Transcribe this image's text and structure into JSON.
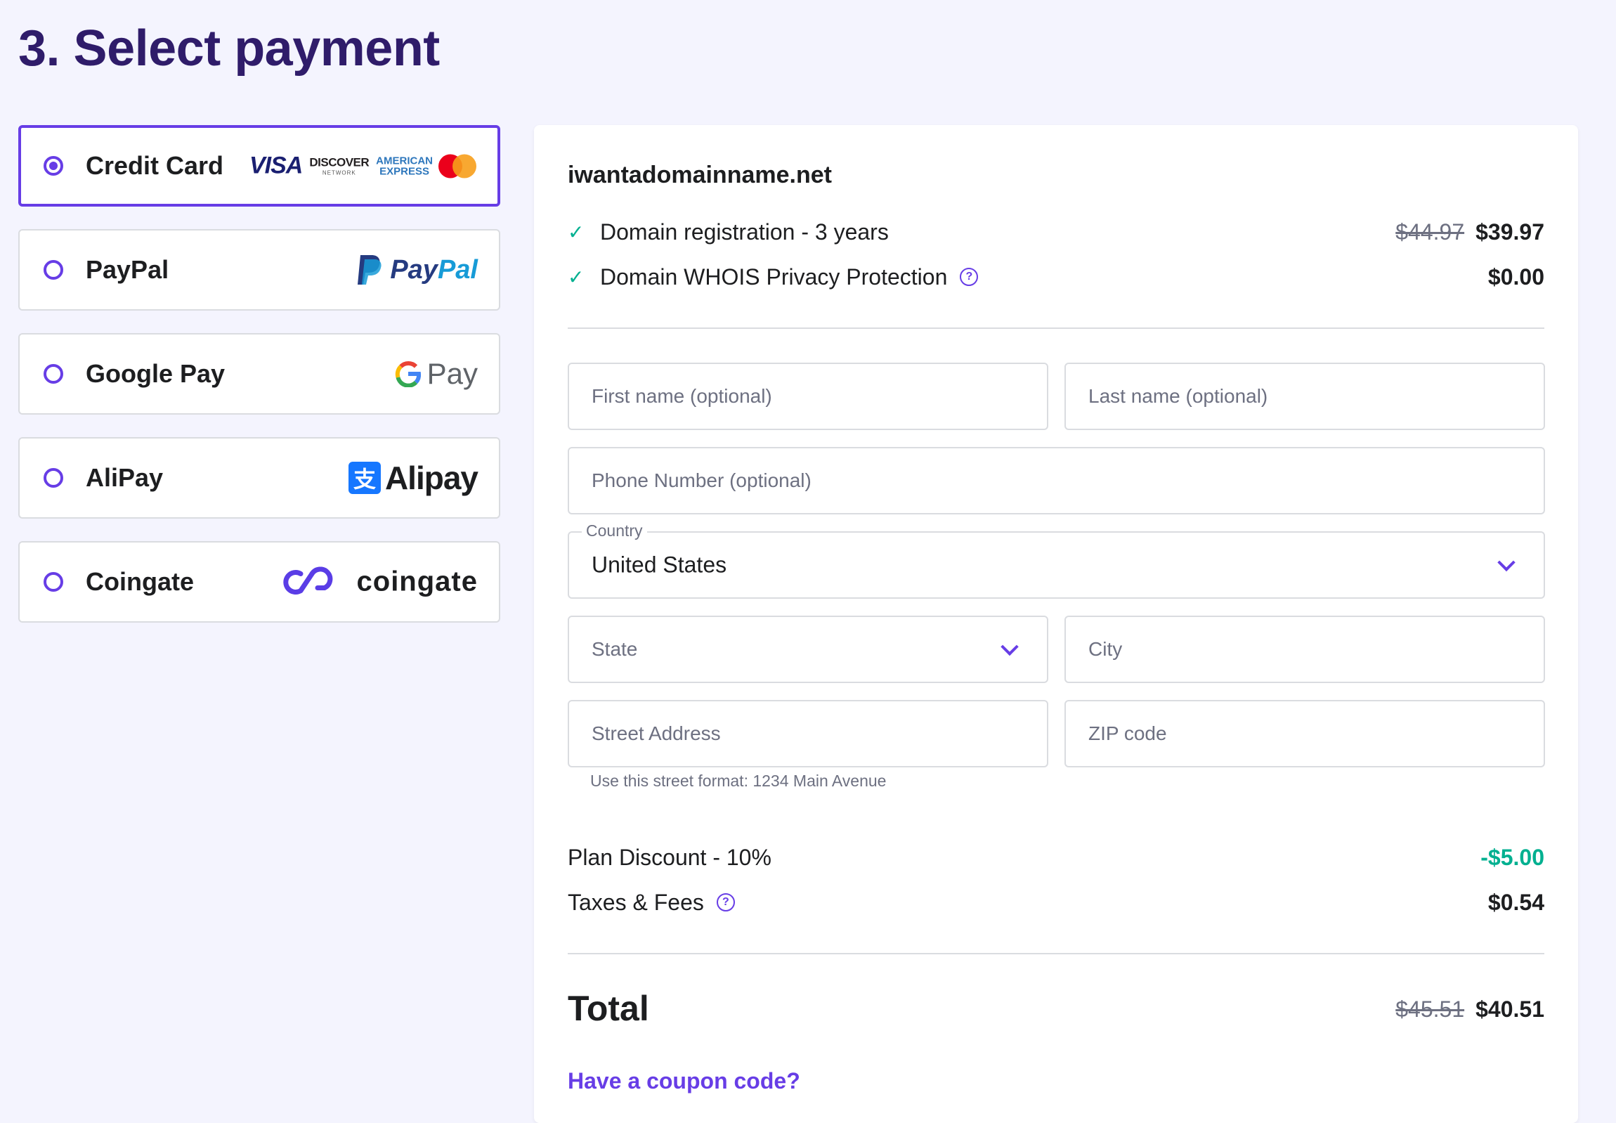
{
  "page": {
    "title": "3. Select payment"
  },
  "colors": {
    "accent": "#673de6",
    "success": "#00b090",
    "title": "#2f1c6a",
    "background": "#f4f4fe"
  },
  "payment_methods": [
    {
      "label": "Credit Card",
      "selected": true,
      "logo_icons": [
        "visa-logo",
        "discover-logo",
        "amex-logo",
        "mastercard-logo"
      ],
      "logo_text": {
        "visa": "VISA",
        "discover": "DISCOVER",
        "discover_sub": "NETWORK",
        "amex_1": "AMERICAN",
        "amex_2": "EXPRESS"
      }
    },
    {
      "label": "PayPal",
      "selected": false,
      "logo_text": {
        "pay": "Pay",
        "pal": "Pal"
      }
    },
    {
      "label": "Google Pay",
      "selected": false,
      "logo_text": {
        "pay": "Pay"
      }
    },
    {
      "label": "AliPay",
      "selected": false,
      "logo_text": {
        "glyph": "支",
        "name": "Alipay"
      }
    },
    {
      "label": "Coingate",
      "selected": false,
      "logo_text": {
        "name": "coingate"
      }
    }
  ],
  "summary": {
    "domain": "iwantadomainname.net",
    "items": [
      {
        "label": "Domain registration - 3 years",
        "old_price": "$44.97",
        "price": "$39.97",
        "icon": "check-icon"
      },
      {
        "label": "Domain WHOIS Privacy Protection",
        "price": "$0.00",
        "icon": "check-icon",
        "help_icon": "help-circle-icon",
        "help_glyph": "?"
      }
    ],
    "form": {
      "first_name_placeholder": "First name (optional)",
      "last_name_placeholder": "Last name (optional)",
      "phone_placeholder": "Phone Number (optional)",
      "country_label": "Country",
      "country_value": "United States",
      "state_placeholder": "State",
      "city_placeholder": "City",
      "street_placeholder": "Street Address",
      "zip_placeholder": "ZIP code",
      "street_hint": "Use this street format: 1234 Main Avenue"
    },
    "discount": {
      "label": "Plan Discount - 10%",
      "price": "-$5.00"
    },
    "taxes": {
      "label": "Taxes & Fees",
      "price": "$0.54",
      "help_glyph": "?"
    },
    "total": {
      "label": "Total",
      "old_price": "$45.51",
      "price": "$40.51"
    },
    "coupon_link": "Have a coupon code?"
  }
}
